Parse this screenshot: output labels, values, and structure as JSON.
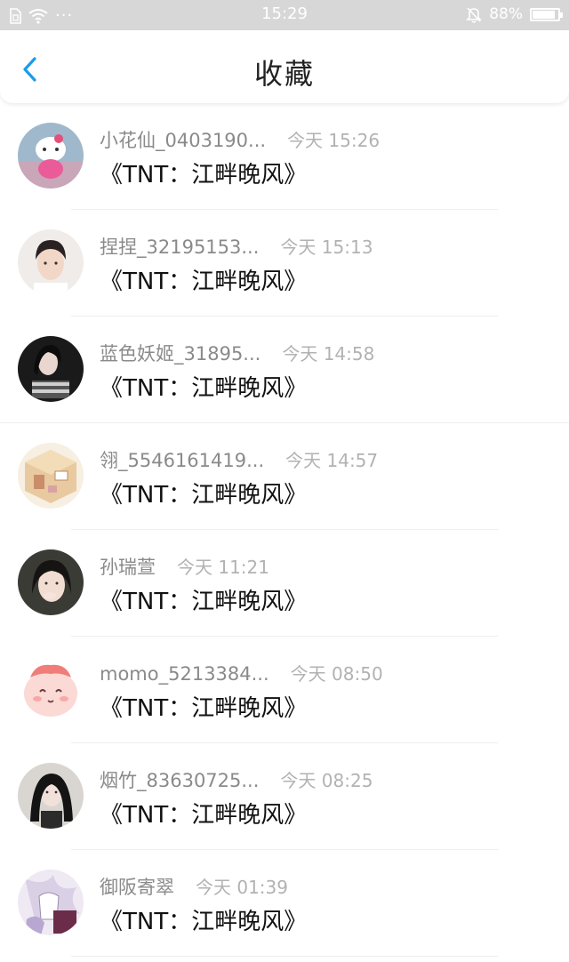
{
  "status_bar": {
    "time": "15:29",
    "battery_text": "88%",
    "battery_level": 0.88,
    "dots": "···"
  },
  "header": {
    "title": "收藏"
  },
  "favorites": [
    {
      "name": "小花仙_0403190...",
      "time": "今天 15:26",
      "title": "《TNT：江畔晚风》"
    },
    {
      "name": "捏捏_32195153...",
      "time": "今天 15:13",
      "title": "《TNT：江畔晚风》"
    },
    {
      "name": "蓝色妖姬_31895...",
      "time": "今天 14:58",
      "title": "《TNT：江畔晚风》"
    },
    {
      "name": "翎_5546161419...",
      "time": "今天 14:57",
      "title": "《TNT：江畔晚风》"
    },
    {
      "name": "孙瑞萱",
      "time": "今天 11:21",
      "title": "《TNT：江畔晚风》"
    },
    {
      "name": "momo_5213384...",
      "time": "今天 08:50",
      "title": "《TNT：江畔晚风》"
    },
    {
      "name": "烟竹_83630725...",
      "time": "今天 08:25",
      "title": "《TNT：江畔晚风》"
    },
    {
      "name": "御阪寄翠",
      "time": "今天 01:39",
      "title": "《TNT：江畔晚风》"
    }
  ],
  "colors": {
    "accent": "#1e9be9",
    "status_bar_bg": "#d7d7d7",
    "name_text": "#8a8a8a",
    "time_text": "#b2b2b2"
  }
}
